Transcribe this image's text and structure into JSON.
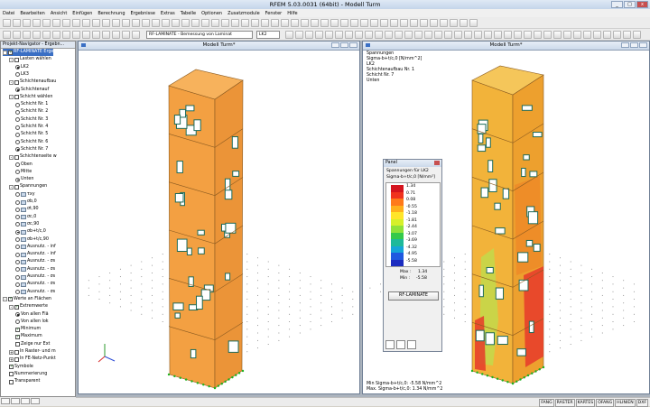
{
  "app": {
    "title": "RFEM 5.03.0031 (64bit) - Modell Turm",
    "window_buttons": [
      "_",
      "□",
      "x"
    ]
  },
  "menu": [
    "Datei",
    "Bearbeiten",
    "Ansicht",
    "Einfügen",
    "Berechnung",
    "Ergebnisse",
    "Extras",
    "Tabelle",
    "Optionen",
    "Zusatzmodule",
    "Fenster",
    "Hilfe"
  ],
  "toolbar": {
    "module_combo": "RF-LAMINATE - Bemessung von Laminat",
    "lc_combo": "LK2",
    "icons": [
      "new-icon",
      "open-icon",
      "save-icon",
      "print-icon",
      "undo-icon",
      "redo-icon",
      "zoom-icon",
      "rotate-icon",
      "results-icon",
      "calc-icon"
    ]
  },
  "navigator": {
    "header": "Projekt-Navigator - Ergebn...",
    "items": [
      {
        "label": "RF-LAMINATE Erge",
        "indent": 0,
        "kind": "check",
        "checked": true,
        "expander": "-",
        "selected": true
      },
      {
        "label": "Lasten wählen",
        "indent": 1,
        "kind": "check",
        "checked": false,
        "expander": "-"
      },
      {
        "label": "LK2",
        "indent": 2,
        "kind": "radio",
        "on": true
      },
      {
        "label": "LK3",
        "indent": 2,
        "kind": "radio",
        "on": false
      },
      {
        "label": "Schichtenaufbau",
        "indent": 1,
        "kind": "check",
        "checked": false,
        "expander": "-"
      },
      {
        "label": "Schichtenauf",
        "indent": 2,
        "kind": "radio",
        "on": true
      },
      {
        "label": "Schicht wählen",
        "indent": 1,
        "kind": "check",
        "checked": false,
        "expander": "-"
      },
      {
        "label": "Schicht Nr. 1",
        "indent": 2,
        "kind": "radio",
        "on": false
      },
      {
        "label": "Schicht Nr. 2",
        "indent": 2,
        "kind": "radio",
        "on": false
      },
      {
        "label": "Schicht Nr. 3",
        "indent": 2,
        "kind": "radio",
        "on": false
      },
      {
        "label": "Schicht Nr. 4",
        "indent": 2,
        "kind": "radio",
        "on": false
      },
      {
        "label": "Schicht Nr. 5",
        "indent": 2,
        "kind": "radio",
        "on": false
      },
      {
        "label": "Schicht Nr. 6",
        "indent": 2,
        "kind": "radio",
        "on": false
      },
      {
        "label": "Schicht Nr. 7",
        "indent": 2,
        "kind": "radio",
        "on": true
      },
      {
        "label": "Schichtenseite w",
        "indent": 1,
        "kind": "check",
        "checked": false,
        "expander": "-"
      },
      {
        "label": "Oben",
        "indent": 2,
        "kind": "radio",
        "on": false
      },
      {
        "label": "Mitte",
        "indent": 2,
        "kind": "radio",
        "on": false
      },
      {
        "label": "Unten",
        "indent": 2,
        "kind": "radio",
        "on": true
      },
      {
        "label": "Spannungen",
        "indent": 1,
        "kind": "check",
        "checked": false,
        "expander": "-"
      },
      {
        "label": "τxy",
        "indent": 2,
        "kind": "radio-ic",
        "on": false
      },
      {
        "label": "σb,0",
        "indent": 2,
        "kind": "radio-ic",
        "on": false
      },
      {
        "label": "σt,90",
        "indent": 2,
        "kind": "radio-ic",
        "on": false
      },
      {
        "label": "σc,0",
        "indent": 2,
        "kind": "radio-ic",
        "on": false
      },
      {
        "label": "σc,90",
        "indent": 2,
        "kind": "radio-ic",
        "on": false
      },
      {
        "label": "σb+t/c,0",
        "indent": 2,
        "kind": "radio-ic",
        "on": true
      },
      {
        "label": "σb+t/c,90",
        "indent": 2,
        "kind": "radio-ic",
        "on": false
      },
      {
        "label": "Ausnutz. - inf",
        "indent": 2,
        "kind": "radio-ic",
        "on": false
      },
      {
        "label": "Ausnutz. - inf",
        "indent": 2,
        "kind": "radio-ic",
        "on": false
      },
      {
        "label": "Ausnutz. - σs",
        "indent": 2,
        "kind": "radio-ic",
        "on": false
      },
      {
        "label": "Ausnutz. - σs",
        "indent": 2,
        "kind": "radio-ic",
        "on": false
      },
      {
        "label": "Ausnutz. - σs",
        "indent": 2,
        "kind": "radio-ic",
        "on": false
      },
      {
        "label": "Ausnutz. - σs",
        "indent": 2,
        "kind": "radio-ic",
        "on": false
      },
      {
        "label": "Ausnutz. - σs",
        "indent": 2,
        "kind": "radio-ic",
        "on": false
      },
      {
        "label": "Werte an Flächen",
        "indent": 0,
        "kind": "check",
        "checked": true,
        "expander": "-"
      },
      {
        "label": "Extremwerte",
        "indent": 1,
        "kind": "check",
        "checked": true,
        "expander": "-"
      },
      {
        "label": "Von allen Flä",
        "indent": 2,
        "kind": "radio",
        "on": true
      },
      {
        "label": "Von allen lok",
        "indent": 2,
        "kind": "radio",
        "on": false
      },
      {
        "label": "Minimum",
        "indent": 2,
        "kind": "check",
        "checked": true
      },
      {
        "label": "Maximum",
        "indent": 2,
        "kind": "check",
        "checked": true
      },
      {
        "label": "Zeige nur Ext",
        "indent": 2,
        "kind": "check",
        "checked": false
      },
      {
        "label": "In Raster- und m",
        "indent": 1,
        "kind": "check",
        "checked": false,
        "expander": "+"
      },
      {
        "label": "In FE-Netz-Punkt",
        "indent": 1,
        "kind": "check",
        "checked": false,
        "expander": "+"
      },
      {
        "label": "Symbole",
        "indent": 1,
        "kind": "check",
        "checked": true
      },
      {
        "label": "Nummerierung",
        "indent": 1,
        "kind": "check",
        "checked": false
      },
      {
        "label": "Transparent",
        "indent": 1,
        "kind": "check",
        "checked": false
      }
    ]
  },
  "windows": {
    "left_title": "Modell Turm*",
    "right_title": "Modell Turm*",
    "right_info": [
      "Spannungen",
      "Sigma-b+t/c,0 [N/mm^2]",
      "LK2",
      "Schichtenaufbau Nr. 1",
      "Schicht Nr. 7",
      "Unten"
    ],
    "right_footer": [
      "Min Sigma-b+t/c,0: -5.58 N/mm^2",
      "Max. Sigma-b+t/c,0: 1.34 N/mm^2"
    ]
  },
  "panel": {
    "title": "Panel",
    "subtitle": "Spannungen für LK2",
    "quantity": "Sigma-b+t/c,0 [N/mm²]",
    "scale": [
      {
        "value": "1.34",
        "color": "#d4141e"
      },
      {
        "value": "0.71",
        "color": "#f0331e"
      },
      {
        "value": "0.08",
        "color": "#ff7a1a"
      },
      {
        "value": "-0.55",
        "color": "#ffb01c"
      },
      {
        "value": "-1.18",
        "color": "#ffe52a"
      },
      {
        "value": "-1.81",
        "color": "#d6f02a"
      },
      {
        "value": "-2.44",
        "color": "#8fe23a"
      },
      {
        "value": "-3.07",
        "color": "#34c94a"
      },
      {
        "value": "-3.69",
        "color": "#1db99a"
      },
      {
        "value": "-4.32",
        "color": "#15a5d8"
      },
      {
        "value": "-4.95",
        "color": "#1f59e0"
      },
      {
        "value": "-5.58",
        "color": "#1b2cc0"
      }
    ],
    "max_label": "Max :",
    "max_value": "1.34",
    "min_label": "Min :",
    "min_value": "-5.58",
    "button": "RF-LAMINATE"
  },
  "statusbar": [
    "FANG",
    "RASTER",
    "KARTES",
    "OFANG",
    "HLINIEN",
    "DXF"
  ]
}
